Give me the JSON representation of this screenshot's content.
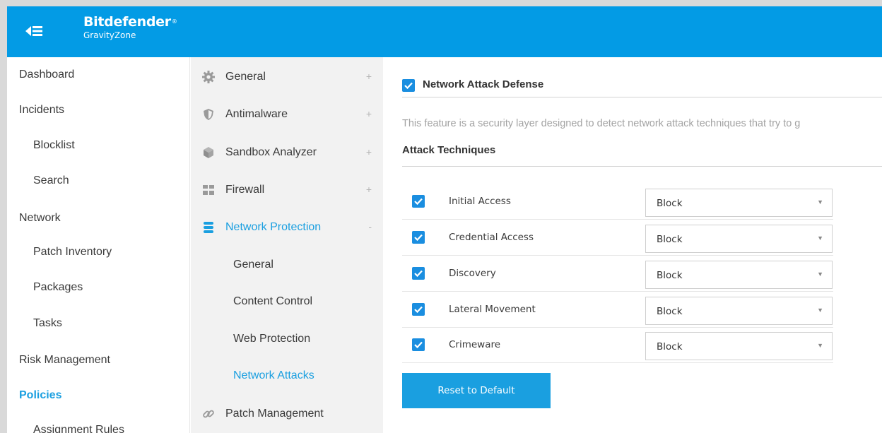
{
  "header": {
    "brand": "Bitdefender",
    "product": "GravityZone",
    "accent_color": "#039be5"
  },
  "nav": {
    "items": [
      {
        "label": "Dashboard"
      },
      {
        "label": "Incidents"
      },
      {
        "label": "Blocklist"
      },
      {
        "label": "Search"
      },
      {
        "label": "Network"
      },
      {
        "label": "Patch Inventory"
      },
      {
        "label": "Packages"
      },
      {
        "label": "Tasks"
      },
      {
        "label": "Risk Management"
      },
      {
        "label": "Policies"
      },
      {
        "label": "Assignment Rules"
      }
    ],
    "active": "Policies"
  },
  "sections": {
    "items": [
      {
        "label": "General",
        "icon": "gear-icon",
        "toggle": "+"
      },
      {
        "label": "Antimalware",
        "icon": "shield-icon",
        "toggle": "+"
      },
      {
        "label": "Sandbox Analyzer",
        "icon": "cube-icon",
        "toggle": "+"
      },
      {
        "label": "Firewall",
        "icon": "firewall-icon",
        "toggle": "+"
      },
      {
        "label": "Network Protection",
        "icon": "database-icon",
        "toggle": "-"
      },
      {
        "label": "Patch Management",
        "icon": "link-icon"
      }
    ],
    "subitems": [
      {
        "label": "General"
      },
      {
        "label": "Content Control"
      },
      {
        "label": "Web Protection"
      },
      {
        "label": "Network Attacks"
      }
    ],
    "active_section": "Network Protection",
    "active_subitem": "Network Attacks"
  },
  "content": {
    "feature_title": "Network Attack Defense",
    "feature_enabled": true,
    "description": "This feature is a security layer designed to detect network attack techniques that try to g",
    "techniques_title": "Attack Techniques",
    "techniques": [
      {
        "label": "Initial Access",
        "checked": true,
        "action": "Block"
      },
      {
        "label": "Credential Access",
        "checked": true,
        "action": "Block"
      },
      {
        "label": "Discovery",
        "checked": true,
        "action": "Block"
      },
      {
        "label": "Lateral Movement",
        "checked": true,
        "action": "Block"
      },
      {
        "label": "Crimeware",
        "checked": true,
        "action": "Block"
      }
    ],
    "reset_label": "Reset to Default"
  }
}
